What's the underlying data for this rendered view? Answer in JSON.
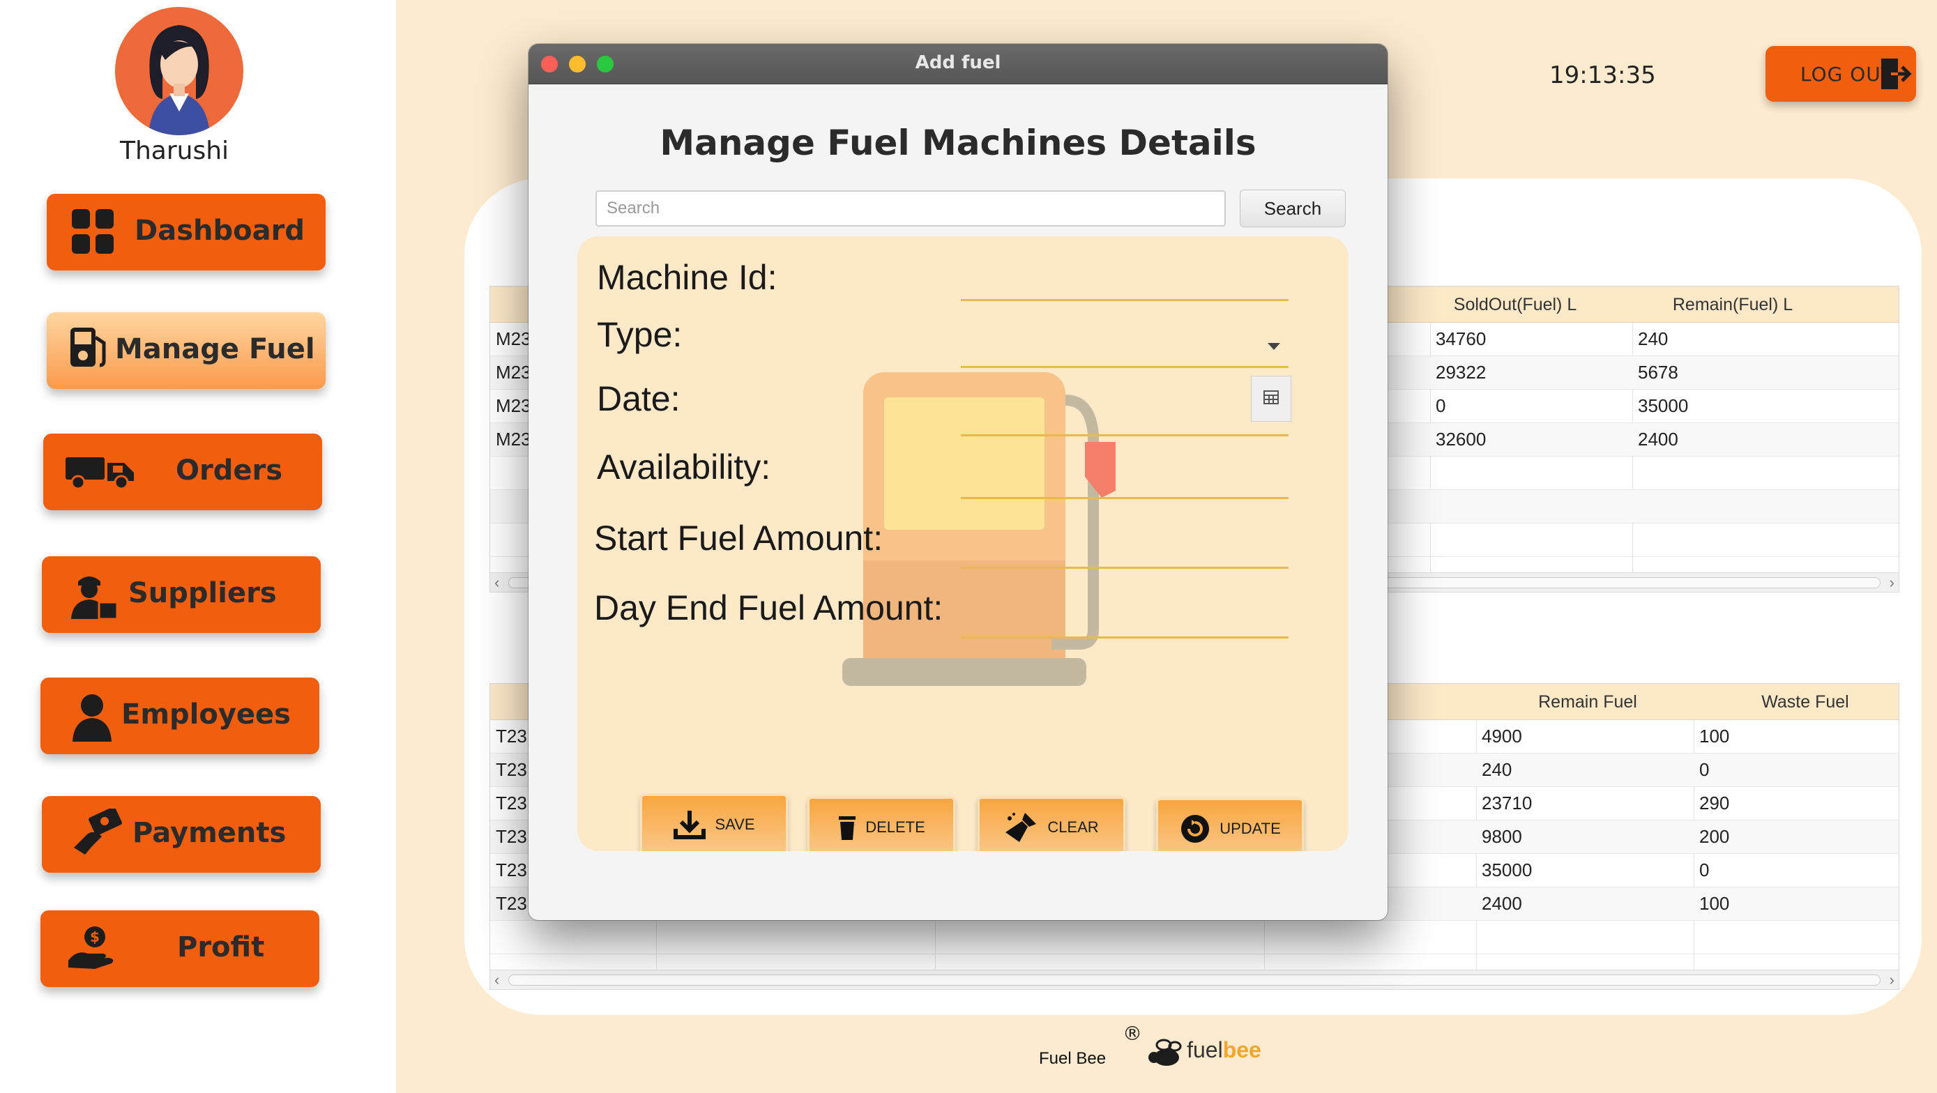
{
  "user": {
    "name": "Tharushi"
  },
  "sidebar": {
    "items": [
      {
        "label": "Dashboard",
        "icon": "dashboard-grid-icon",
        "active": false
      },
      {
        "label": "Manage Fuel",
        "icon": "fuel-pump-icon",
        "active": true
      },
      {
        "label": "Orders",
        "icon": "delivery-truck-icon",
        "active": false
      },
      {
        "label": "Suppliers",
        "icon": "supplier-person-icon",
        "active": false
      },
      {
        "label": "Employees",
        "icon": "employee-person-icon",
        "active": false
      },
      {
        "label": "Payments",
        "icon": "payment-hand-icon",
        "active": false
      },
      {
        "label": "Profit",
        "icon": "profit-hand-coin-icon",
        "active": false
      }
    ]
  },
  "header": {
    "clock": "19:13:35",
    "logout_label": "LOG OUT"
  },
  "machines_table": {
    "columns": [
      "SoldOut(Fuel) L",
      "Remain(Fuel) L"
    ],
    "rows": [
      {
        "id_prefix": "M23",
        "sold": "34760",
        "remain": "240"
      },
      {
        "id_prefix": "M23",
        "sold": "29322",
        "remain": "5678"
      },
      {
        "id_prefix": "M23",
        "sold": "0",
        "remain": "35000"
      },
      {
        "id_prefix": "M23",
        "sold": "32600",
        "remain": "2400"
      }
    ]
  },
  "tanks_table": {
    "columns": [
      "Remain Fuel",
      "Waste Fuel"
    ],
    "rows": [
      {
        "id_prefix": "T23",
        "remain": "4900",
        "waste": "100"
      },
      {
        "id_prefix": "T23",
        "remain": "240",
        "waste": "0"
      },
      {
        "id_prefix": "T23",
        "remain": "23710",
        "waste": "290"
      },
      {
        "id_prefix": "T23",
        "remain": "9800",
        "waste": "200"
      },
      {
        "id_prefix": "T23",
        "remain": "35000",
        "waste": "0"
      },
      {
        "id_prefix": "T23",
        "remain": "2400",
        "waste": "100"
      }
    ]
  },
  "footer": {
    "text": "Fuel Bee",
    "reg_mark": "®",
    "logo_part1": "fuel",
    "logo_part2": "bee"
  },
  "dialog": {
    "title": "Add fuel",
    "heading": "Manage Fuel Machines Details",
    "search": {
      "placeholder": "Search",
      "button_label": "Search"
    },
    "form": {
      "machine_id_label": "Machine Id:",
      "type_label": "Type:",
      "date_label": "Date:",
      "availability_label": "Availability:",
      "start_fuel_label": "Start Fuel Amount:",
      "day_end_fuel_label": "Day End Fuel Amount:"
    },
    "buttons": {
      "save": "SAVE",
      "delete": "DELETE",
      "clear": "CLEAR",
      "update": "UPDATE"
    }
  },
  "colors": {
    "accent_orange": "#f05e0e",
    "background_cream": "#fdebd0",
    "form_card": "#fde9c8",
    "button_gradient_top": "#f9a640",
    "field_underline": "#e9b94a"
  }
}
